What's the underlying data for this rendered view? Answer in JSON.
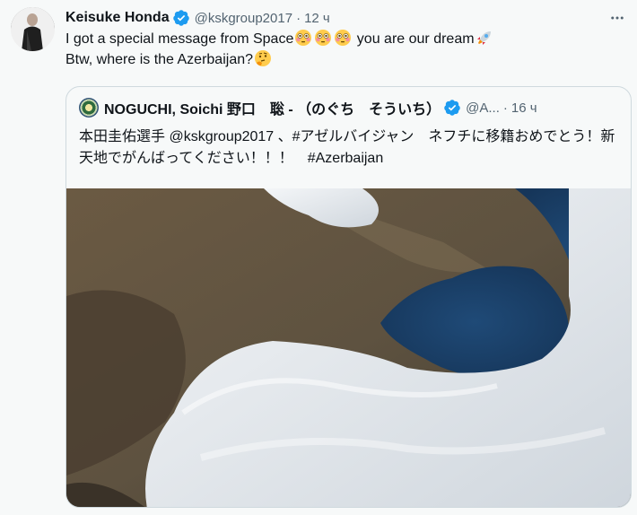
{
  "tweet": {
    "author_name": "Keisuke Honda",
    "handle": "@kskgroup2017",
    "separator": "·",
    "time": "12 ч",
    "more_icon": "more-horizontal-icon",
    "text_part1": "I got a special message from Space",
    "text_part2": " you are our dream",
    "text_line2": "Btw, where is the Azerbaijan?"
  },
  "quote": {
    "author_name": "NOGUCHI, Soichi 野口　聡 - （のぐち　そういち）",
    "handle": "@A...",
    "separator": "·",
    "time": "16 ч",
    "text": "本田圭佑選手 @kskgroup2017 、#アゼルバイジャン　ネフチに移籍おめでとう！新天地でがんばってください！！！　#Azerbaijan",
    "media": "space-photo-azerbaijan"
  },
  "colors": {
    "verified": "#1d9bf0",
    "secondary_text": "#536471",
    "border": "#cfd9de",
    "background": "#f7f9f9"
  }
}
